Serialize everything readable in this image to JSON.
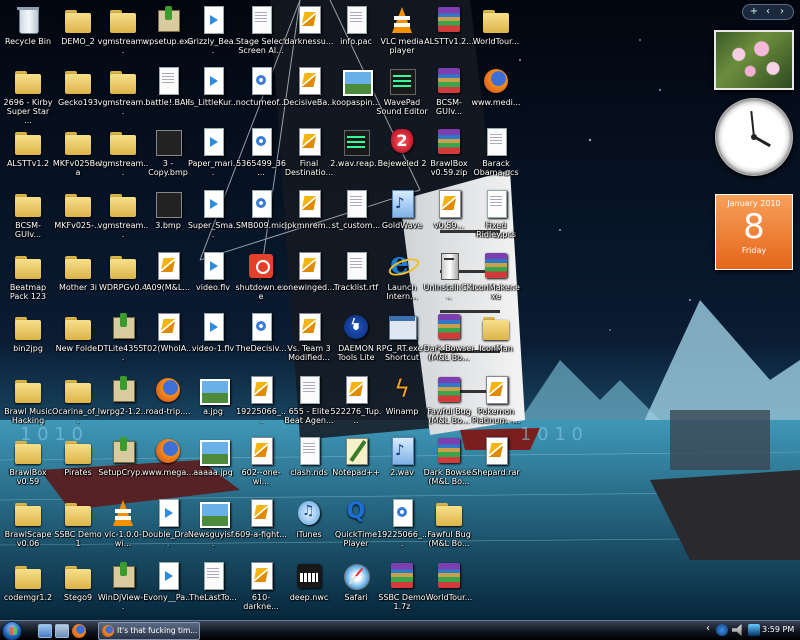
{
  "desktop": {
    "icons": [
      {
        "label": "Recycle Bin",
        "kind": "recycle",
        "col": 0,
        "row": 0
      },
      {
        "label": "DEMO_2",
        "kind": "folder",
        "col": 1,
        "row": 0
      },
      {
        "label": "vgmstream...",
        "kind": "folder",
        "col": 2,
        "row": 0
      },
      {
        "label": "wpsetup.exe",
        "kind": "installer",
        "col": 3,
        "row": 0
      },
      {
        "label": "Grizzly_Bea...",
        "kind": "wmp",
        "col": 4,
        "row": 0
      },
      {
        "label": "Stage Select Screen Al...",
        "kind": "doc",
        "col": 5,
        "row": 0
      },
      {
        "label": "darknessu...",
        "kind": "mp3",
        "col": 6,
        "row": 0
      },
      {
        "label": "info.pac",
        "kind": "doc",
        "col": 7,
        "row": 0
      },
      {
        "label": "VLC media player",
        "kind": "vlc",
        "col": 8,
        "row": 0
      },
      {
        "label": "ALSTTv1.2...",
        "kind": "rar",
        "col": 9,
        "row": 0
      },
      {
        "label": "WorldTour...",
        "kind": "folder",
        "col": 10,
        "row": 0
      },
      {
        "label": "2696 - Kirby Super Star ...",
        "kind": "folder",
        "col": 0,
        "row": 1
      },
      {
        "label": "Gecko193",
        "kind": "folder",
        "col": 1,
        "row": 1
      },
      {
        "label": "vgmstream...",
        "kind": "folder",
        "col": 2,
        "row": 1
      },
      {
        "label": "battle!.BAK",
        "kind": "doc",
        "col": 3,
        "row": 1
      },
      {
        "label": "Is_LittleKur...",
        "kind": "wmp",
        "col": 4,
        "row": 1
      },
      {
        "label": "nocturneof...",
        "kind": "media",
        "col": 5,
        "row": 1
      },
      {
        "label": "DecisiveBa...",
        "kind": "mp3",
        "col": 6,
        "row": 1
      },
      {
        "label": "koopaspin...",
        "kind": "image",
        "col": 7,
        "row": 1
      },
      {
        "label": "WavePad Sound Editor",
        "kind": "wave",
        "col": 8,
        "row": 1
      },
      {
        "label": "BCSM-GUIv...",
        "kind": "rar",
        "col": 9,
        "row": 1
      },
      {
        "label": "www.medi...",
        "kind": "firefox",
        "col": 10,
        "row": 1
      },
      {
        "label": "ALSTTv1.2",
        "kind": "folder",
        "col": 0,
        "row": 2
      },
      {
        "label": "MKFv025Beta",
        "kind": "folder",
        "col": 1,
        "row": 2
      },
      {
        "label": "vgmstream...",
        "kind": "folder",
        "col": 2,
        "row": 2
      },
      {
        "label": "3 - Copy.bmp",
        "kind": "dark",
        "col": 3,
        "row": 2
      },
      {
        "label": "Paper_mari...",
        "kind": "wmp",
        "col": 4,
        "row": 2
      },
      {
        "label": "5365499_36...",
        "kind": "media",
        "col": 5,
        "row": 2
      },
      {
        "label": "Final Destinatio...",
        "kind": "mp3",
        "col": 6,
        "row": 2
      },
      {
        "label": "2.wav.reap...",
        "kind": "wave",
        "col": 7,
        "row": 2
      },
      {
        "label": "Bejeweled 2",
        "kind": "gem",
        "col": 8,
        "row": 2
      },
      {
        "label": "BrawlBox v0.59.zip",
        "kind": "rar",
        "col": 9,
        "row": 2
      },
      {
        "label": "Barack Obama.pcs",
        "kind": "doc",
        "col": 10,
        "row": 2
      },
      {
        "label": "BCSM-GUIv...",
        "kind": "folder",
        "col": 0,
        "row": 3
      },
      {
        "label": "MKFv025-...",
        "kind": "folder",
        "col": 1,
        "row": 3
      },
      {
        "label": "vgmstream...",
        "kind": "folder",
        "col": 2,
        "row": 3
      },
      {
        "label": "3.bmp",
        "kind": "dark",
        "col": 3,
        "row": 3
      },
      {
        "label": "Super_Sma...",
        "kind": "wmp",
        "col": 4,
        "row": 3
      },
      {
        "label": "SMB009.mid",
        "kind": "media",
        "col": 5,
        "row": 3
      },
      {
        "label": "jpkmnrem...",
        "kind": "mp3",
        "col": 6,
        "row": 3
      },
      {
        "label": "st_custom...",
        "kind": "doc",
        "col": 7,
        "row": 3
      },
      {
        "label": "GoldWave",
        "kind": "audio",
        "col": 8,
        "row": 3
      },
      {
        "label": "v0.59...",
        "kind": "mp3",
        "col": 9,
        "row": 3
      },
      {
        "label": "Fixed Ridley.pcs",
        "kind": "doc",
        "col": 10,
        "row": 3
      },
      {
        "label": "Beatmap Pack 123",
        "kind": "folder",
        "col": 0,
        "row": 4
      },
      {
        "label": "Mother 3i",
        "kind": "folder",
        "col": 1,
        "row": 4
      },
      {
        "label": "WDRPGv0.4",
        "kind": "folder",
        "col": 2,
        "row": 4
      },
      {
        "label": "A09(M&L...",
        "kind": "mp3",
        "col": 3,
        "row": 4
      },
      {
        "label": "video.flv",
        "kind": "wmp",
        "col": 4,
        "row": 4
      },
      {
        "label": "shutdown.exe",
        "kind": "red",
        "col": 5,
        "row": 4
      },
      {
        "label": "onewinged...",
        "kind": "mp3",
        "col": 6,
        "row": 4
      },
      {
        "label": "Tracklist.rtf",
        "kind": "doc",
        "col": 7,
        "row": 4
      },
      {
        "label": "Launch Intern...",
        "kind": "ie",
        "col": 8,
        "row": 4
      },
      {
        "label": "UnInstall.CK...",
        "kind": "tower",
        "col": 9,
        "row": 4
      },
      {
        "label": "IconMaker.exe",
        "kind": "rar",
        "col": 10,
        "row": 4
      },
      {
        "label": "bin2jpg",
        "kind": "folder",
        "col": 0,
        "row": 5
      },
      {
        "label": "New Folder",
        "kind": "folder",
        "col": 1,
        "row": 5
      },
      {
        "label": "DTLite4355...",
        "kind": "installer",
        "col": 2,
        "row": 5
      },
      {
        "label": "T02(WhoIA...",
        "kind": "mp3",
        "col": 3,
        "row": 5
      },
      {
        "label": "video-1.flv",
        "kind": "wmp",
        "col": 4,
        "row": 5
      },
      {
        "label": "TheDecisiv...",
        "kind": "media",
        "col": 5,
        "row": 5
      },
      {
        "label": "Vs. Team 3 Modified...",
        "kind": "mp3",
        "col": 6,
        "row": 5
      },
      {
        "label": "DAEMON Tools Lite",
        "kind": "daemon",
        "col": 7,
        "row": 5
      },
      {
        "label": "RPG_RT.exe - Shortcut",
        "kind": "exe",
        "col": 8,
        "row": 5
      },
      {
        "label": "Dark Bowser (M&L Bo...",
        "kind": "rar",
        "col": 9,
        "row": 5
      },
      {
        "label": "IconMan",
        "kind": "folder",
        "col": 10,
        "row": 5
      },
      {
        "label": "Brawl Music Hacking",
        "kind": "folder",
        "col": 0,
        "row": 6
      },
      {
        "label": "Ocarina_of_...",
        "kind": "folder",
        "col": 1,
        "row": 6
      },
      {
        "label": "lwrpg2-1.2...",
        "kind": "installer",
        "col": 2,
        "row": 6
      },
      {
        "label": "road-trip....",
        "kind": "firefox",
        "col": 3,
        "row": 6
      },
      {
        "label": "a.jpg",
        "kind": "image",
        "col": 4,
        "row": 6
      },
      {
        "label": "19225066_...",
        "kind": "mp3",
        "col": 5,
        "row": 6
      },
      {
        "label": "655 - Elite Beat Agen...",
        "kind": "doc",
        "col": 6,
        "row": 6
      },
      {
        "label": "522276_Tup...",
        "kind": "mp3",
        "col": 7,
        "row": 6
      },
      {
        "label": "Winamp",
        "kind": "winamp",
        "col": 8,
        "row": 6
      },
      {
        "label": "Fawful Bug (M&L Bo...",
        "kind": "rar",
        "col": 9,
        "row": 6
      },
      {
        "label": "Pokemon Platinum -...",
        "kind": "mp3",
        "col": 10,
        "row": 6
      },
      {
        "label": "BrawlBox v0.59",
        "kind": "folder",
        "col": 0,
        "row": 7
      },
      {
        "label": "Pirates",
        "kind": "folder",
        "col": 1,
        "row": 7
      },
      {
        "label": "SetupCryp...",
        "kind": "installer",
        "col": 2,
        "row": 7
      },
      {
        "label": "www.mega...",
        "kind": "firefox",
        "col": 3,
        "row": 7
      },
      {
        "label": "aaaaa.jpg",
        "kind": "image",
        "col": 4,
        "row": 7
      },
      {
        "label": "602--one-wi...",
        "kind": "mp3",
        "col": 5,
        "row": 7
      },
      {
        "label": "clash.nds",
        "kind": "doc",
        "col": 6,
        "row": 7
      },
      {
        "label": "Notepad++",
        "kind": "notepad",
        "col": 7,
        "row": 7
      },
      {
        "label": "2.wav",
        "kind": "audio",
        "col": 8,
        "row": 7
      },
      {
        "label": "Dark Bowser (M&L Bo...",
        "kind": "rar",
        "col": 9,
        "row": 7
      },
      {
        "label": "Shepard.rar",
        "kind": "mp3",
        "col": 10,
        "row": 7
      },
      {
        "label": "BrawlScape v0.06",
        "kind": "folder",
        "col": 0,
        "row": 8
      },
      {
        "label": "SSBC Demo 1",
        "kind": "folder",
        "col": 1,
        "row": 8
      },
      {
        "label": "vlc-1.0.0-wi...",
        "kind": "vlc",
        "col": 2,
        "row": 8
      },
      {
        "label": "Double_Dra...",
        "kind": "wmp",
        "col": 3,
        "row": 8
      },
      {
        "label": "Newsguyisf...",
        "kind": "image",
        "col": 4,
        "row": 8
      },
      {
        "label": "609-a-fight...",
        "kind": "mp3",
        "col": 5,
        "row": 8
      },
      {
        "label": "iTunes",
        "kind": "itunes",
        "col": 6,
        "row": 8
      },
      {
        "label": "QuickTime Player",
        "kind": "quicktime",
        "col": 7,
        "row": 8
      },
      {
        "label": "19225066_...",
        "kind": "media",
        "col": 8,
        "row": 8
      },
      {
        "label": "Fawful Bug (M&L Bo...",
        "kind": "folder",
        "col": 9,
        "row": 8
      },
      {
        "label": "codemgr1.2",
        "kind": "folder",
        "col": 0,
        "row": 9
      },
      {
        "label": "Stego9",
        "kind": "folder",
        "col": 1,
        "row": 9
      },
      {
        "label": "WinDjView-...",
        "kind": "installer",
        "col": 2,
        "row": 9
      },
      {
        "label": "Evony__Pa...",
        "kind": "wmp",
        "col": 3,
        "row": 9
      },
      {
        "label": "TheLastTo...",
        "kind": "doc",
        "col": 4,
        "row": 9
      },
      {
        "label": "610-darkne...",
        "kind": "mp3",
        "col": 5,
        "row": 9
      },
      {
        "label": "deep.nwc",
        "kind": "music-app",
        "col": 6,
        "row": 9
      },
      {
        "label": "Safari",
        "kind": "safari",
        "col": 7,
        "row": 9
      },
      {
        "label": "SSBC Demo 1.7z",
        "kind": "rar",
        "col": 8,
        "row": 9
      },
      {
        "label": "WorldTour...",
        "kind": "rar",
        "col": 9,
        "row": 9
      }
    ]
  },
  "sidebar": {
    "top_controls": [
      "+",
      "‹",
      "›"
    ],
    "clock": {
      "hour": 3,
      "minute": 59
    },
    "calendar": {
      "month": "January 2010",
      "day": "8",
      "weekday": "Friday"
    }
  },
  "taskbar": {
    "task_label": "It's that fucking tim...",
    "tray_chevron": "‹",
    "time": "3:59 PM"
  }
}
